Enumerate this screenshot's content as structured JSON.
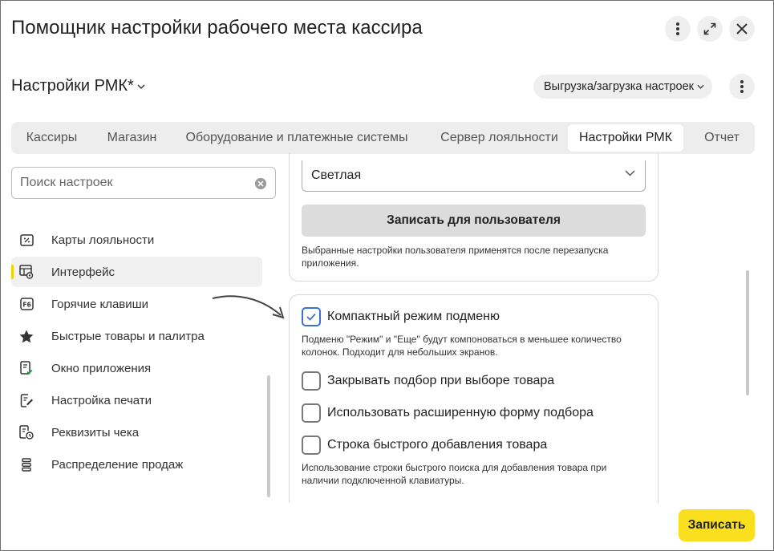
{
  "window": {
    "title": "Помощник настройки рабочего места кассира"
  },
  "header": {
    "subtitle": "Настройки РМК*",
    "io_button_label": "Выгрузка/загрузка настроек"
  },
  "tabs": [
    {
      "label": "Кассиры",
      "active": false
    },
    {
      "label": "Магазин",
      "active": false
    },
    {
      "label": "Оборудование и платежные системы",
      "active": false
    },
    {
      "label": "Сервер лояльности",
      "active": false
    },
    {
      "label": "Настройки РМК",
      "active": true
    },
    {
      "label": "Отчет",
      "active": false
    }
  ],
  "search": {
    "placeholder": "Поиск настроек",
    "value": ""
  },
  "sidebar": {
    "items": [
      {
        "label": "Карты лояльности",
        "icon": "loyalty-card-icon"
      },
      {
        "label": "Интерфейс",
        "icon": "interface-settings-icon",
        "active": true
      },
      {
        "label": "Горячие клавиши",
        "icon": "f6-key-icon"
      },
      {
        "label": "Быстрые товары и палитра",
        "icon": "star-icon"
      },
      {
        "label": "Окно приложения",
        "icon": "app-window-icon"
      },
      {
        "label": "Настройка печати",
        "icon": "print-edit-icon"
      },
      {
        "label": "Реквизиты чека",
        "icon": "receipt-clock-icon"
      },
      {
        "label": "Распределение продаж",
        "icon": "stack-icon"
      }
    ]
  },
  "theme_card": {
    "select_value": "Светлая",
    "save_user_label": "Записать для пользователя",
    "note": "Выбранные настройки пользователя применятся после перезапуска приложения."
  },
  "options_card": {
    "compact_submenu": {
      "label": "Компактный режим подменю",
      "checked": true,
      "note": "Подменю \"Режим\" и \"Еще\" будут компоноваться в меньшее количество колонок. Подходит для небольших экранов."
    },
    "close_picker": {
      "label": "Закрывать подбор при выборе товара",
      "checked": false
    },
    "extended_picker": {
      "label": "Использовать расширенную форму подбора",
      "checked": false
    },
    "quick_add_row": {
      "label": "Строка быстрого добавления товара",
      "checked": false,
      "note": "Использование строки быстрого поиска для добавления товара при наличии подключенной клавиатуры."
    }
  },
  "footer": {
    "submit_label": "Записать"
  },
  "colors": {
    "accent_yellow": "#f9df1d",
    "checkbox_blue": "#3b6fd9"
  }
}
